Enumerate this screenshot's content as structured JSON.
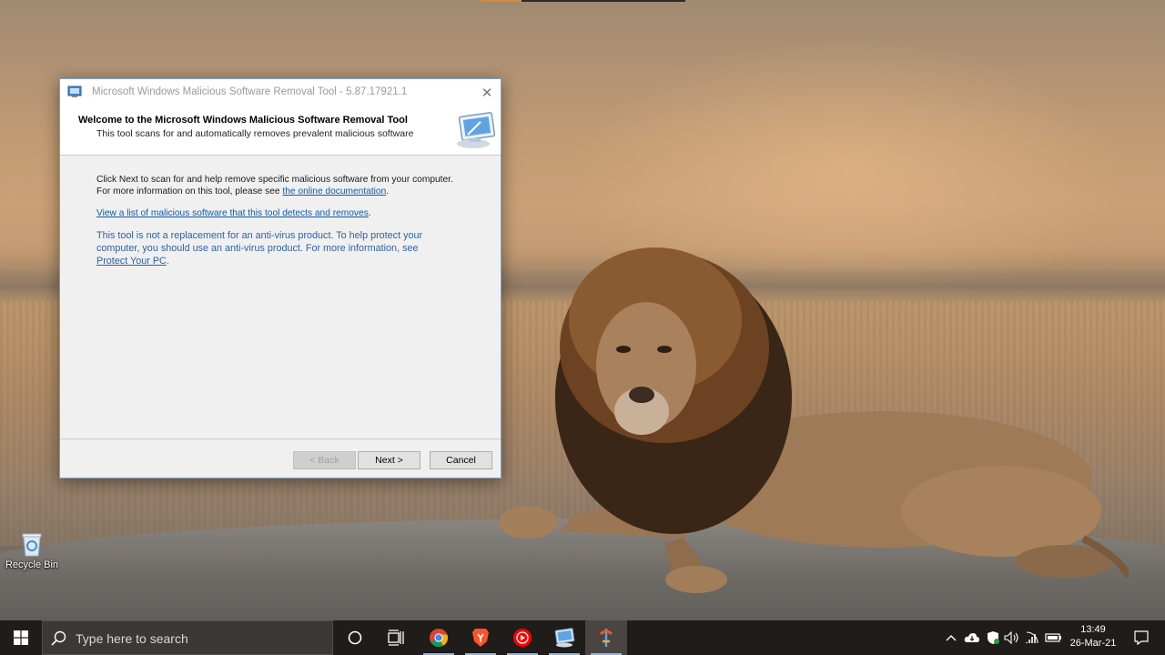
{
  "desktop": {
    "icons": [
      {
        "label": "Recycle Bin"
      }
    ]
  },
  "dialog": {
    "title": "Microsoft Windows Malicious Software Removal Tool - 5.87.17921.1",
    "close_label": "✕",
    "header": {
      "title": "Welcome to the Microsoft Windows Malicious Software Removal Tool",
      "subtitle": "This tool scans for and automatically removes prevalent malicious software"
    },
    "intro_line1": "Click Next to scan for and help remove specific malicious software from your computer.",
    "intro_line2_prefix": "For more information on this tool, please see ",
    "intro_link": "the online documentation",
    "intro_line2_suffix": ".",
    "list_link": "View a list of malicious software that this tool detects and removes",
    "list_suffix": ".",
    "note_line1": "This tool is not a replacement for an anti-virus product. To help protect your",
    "note_line2": "computer, you should use an anti-virus product. For more information, see",
    "note_link": "Protect Your PC",
    "note_suffix": ".",
    "buttons": {
      "back": "< Back",
      "next": "Next >",
      "cancel": "Cancel"
    }
  },
  "taskbar": {
    "search_placeholder": "Type here to search",
    "apps": [
      "cortana-icon",
      "task-view-icon",
      "chrome-icon",
      "brave-icon",
      "youtube-music-icon",
      "msrt-icon",
      "app-pin-icon"
    ],
    "tray": [
      "chevron-up-icon",
      "onedrive-icon",
      "defender-icon",
      "volume-icon",
      "wifi-icon",
      "battery-icon"
    ],
    "time": "13:49",
    "date": "26-Mar-21"
  },
  "colors": {
    "accent": "#0b5cad",
    "taskbar": "#1f1c1a",
    "dialog_bg": "#f0f0f0"
  }
}
